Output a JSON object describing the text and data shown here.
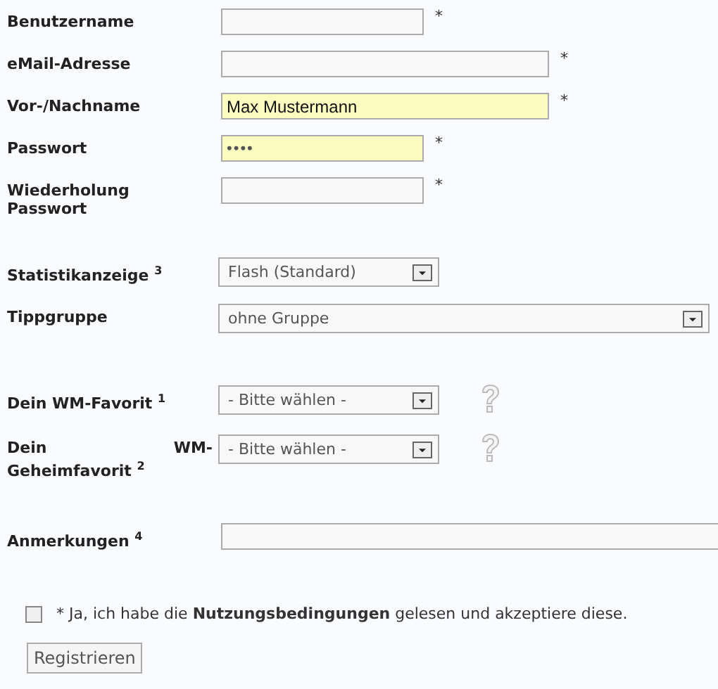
{
  "sections": [
    {
      "fields": [
        {
          "label": "Benutzername",
          "kind": "text",
          "highlighted": false,
          "mark": "*"
        },
        {
          "label": "eMail-Adresse",
          "kind": "text",
          "highlighted": false,
          "mark": "*"
        },
        {
          "label": "Vor-/Nachname",
          "kind": "text",
          "value": "Max Mustermann",
          "highlighted": true,
          "mark": "*"
        },
        {
          "label": "Passwort",
          "kind": "password",
          "value": "••••",
          "highlighted": true,
          "mark": "*"
        },
        {
          "label": "Wiederholung Passwort",
          "kind": "password",
          "highlighted": false,
          "mark": "*"
        }
      ]
    },
    {
      "fields": [
        {
          "label": "Statistikanzeige $^{3}$",
          "kind": "select",
          "value": "Flash (Standard)"
        },
        {
          "label": "Tippgruppe",
          "kind": "select",
          "value": "ohne Gruppe"
        }
      ]
    },
    {
      "fields": [
        {
          "label": "Dein WM-Favorit $^{1}$",
          "kind": "select",
          "value": "- Bitte wählen -",
          "help": true
        },
        {
          "label": "Dein WM-Geheimfavorit $^{2}$",
          "kind": "select",
          "value": "- Bitte wählen -",
          "help": true
        }
      ]
    },
    {
      "fields": [
        {
          "label": "Anmerkungen $^{4}$",
          "kind": "text",
          "highlighted": false
        }
      ]
    }
  ],
  "terms": {
    "checked": false,
    "text": "* Ja, ich habe die **Nutzungsbedingungen** gelesen und akzeptiere diese."
  },
  "submit": "Registrieren"
}
